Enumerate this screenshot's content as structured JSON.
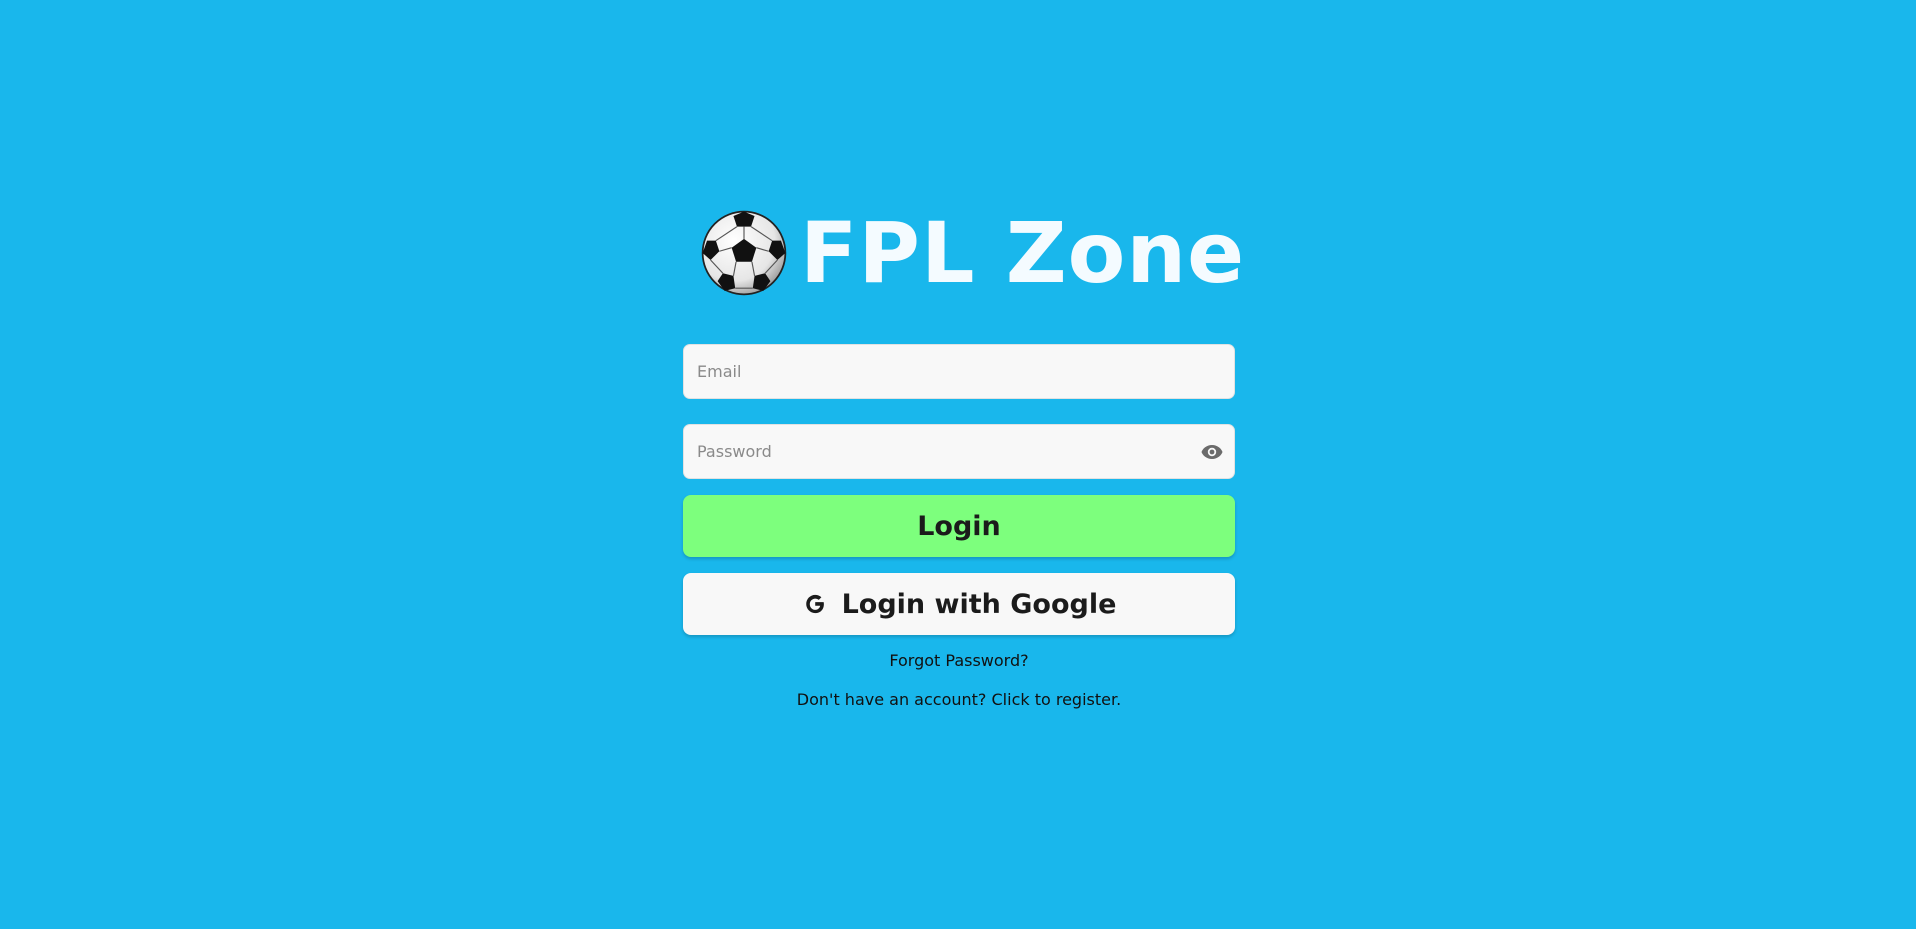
{
  "brand": {
    "title": "FPL Zone",
    "logo_icon": "soccer-ball-icon"
  },
  "form": {
    "email": {
      "placeholder": "Email",
      "value": ""
    },
    "password": {
      "placeholder": "Password",
      "value": "",
      "toggle_icon": "eye-icon"
    },
    "login_label": "Login",
    "google_label": "Login with Google",
    "google_icon": "google-g-icon"
  },
  "links": {
    "forgot": "Forgot Password?",
    "register": "Don't have an account? Click to register."
  },
  "colors": {
    "background": "#19b7ec",
    "login_button": "#7dff7d",
    "input_background": "#f8f8f8",
    "title": "#f4fbff"
  }
}
